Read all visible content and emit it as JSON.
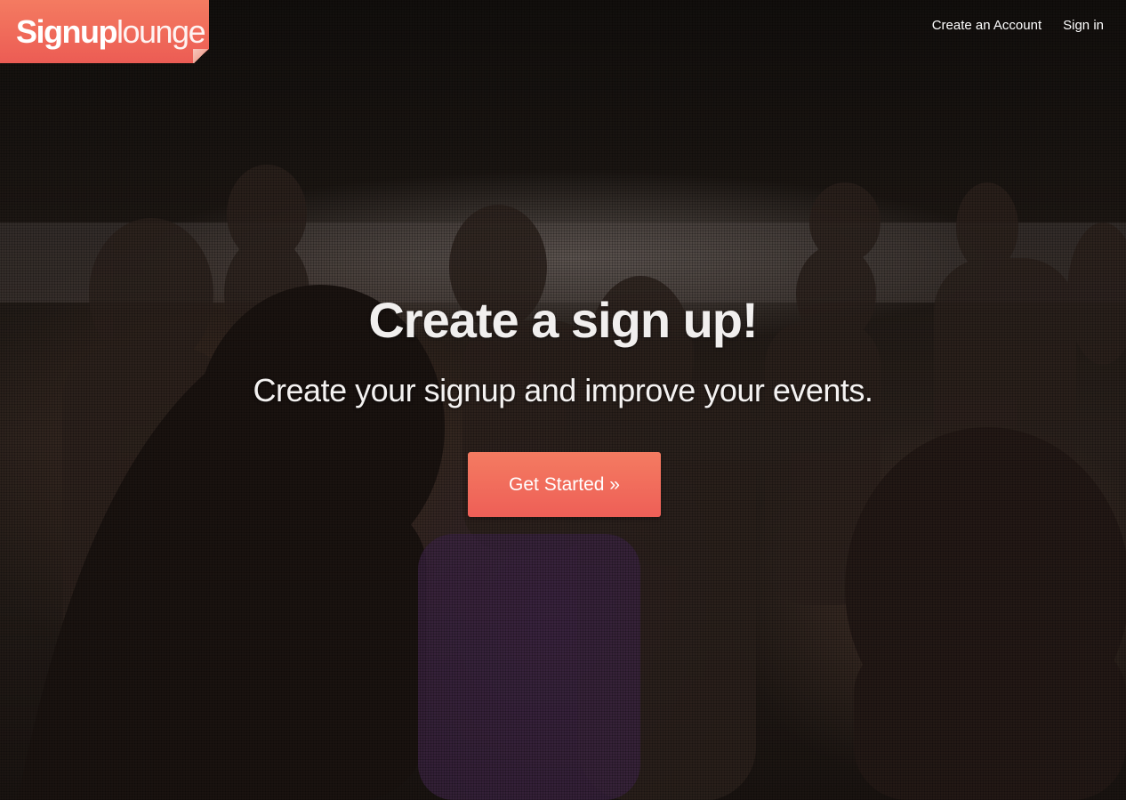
{
  "brand": {
    "logo_bold": "Signup",
    "logo_light": "lounge",
    "accent_color": "#f26b5b"
  },
  "nav": {
    "items": [
      {
        "label": "Create an Account"
      },
      {
        "label": "Sign in"
      }
    ]
  },
  "hero": {
    "headline": "Create a sign up!",
    "subheadline": "Create your signup and improve your events.",
    "cta_label": "Get Started »",
    "background": "photo-of-crowd-at-beach"
  }
}
